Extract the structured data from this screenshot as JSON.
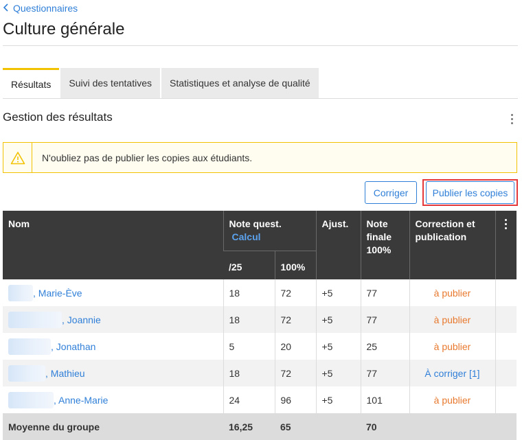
{
  "nav": {
    "back_label": "Questionnaires"
  },
  "page": {
    "title": "Culture générale"
  },
  "tabs": [
    {
      "label": "Résultats",
      "active": true
    },
    {
      "label": "Suivi des tentatives",
      "active": false
    },
    {
      "label": "Statistiques et analyse de qualité",
      "active": false
    }
  ],
  "section": {
    "title": "Gestion des résultats"
  },
  "alert": {
    "text": "N'oubliez pas de publier les copies aux étudiants."
  },
  "actions": {
    "corriger_label": "Corriger",
    "publier_label": "Publier les copies"
  },
  "table": {
    "headers": {
      "name": "Nom",
      "note_quest": "Note quest.",
      "calc_link": "Calcul",
      "adjust": "Ajust.",
      "final": "Note finale 100%",
      "correction": "Correction et publication",
      "sub_score": "/25",
      "sub_percent": "100%"
    },
    "rows": [
      {
        "name": ", Marie-Ève",
        "score": "18",
        "percent": "72",
        "adjust": "+5",
        "final": "77",
        "status": "à publier",
        "status_color": "#e8792e"
      },
      {
        "name": ", Joannie",
        "score": "18",
        "percent": "72",
        "adjust": "+5",
        "final": "77",
        "status": "à publier",
        "status_color": "#e8792e"
      },
      {
        "name": ", Jonathan",
        "score": "5",
        "percent": "20",
        "adjust": "+5",
        "final": "25",
        "status": "à publier",
        "status_color": "#e8792e"
      },
      {
        "name": ", Mathieu",
        "score": "18",
        "percent": "72",
        "adjust": "+5",
        "final": "77",
        "status": "À corriger [1]",
        "status_color": "#2f7fd8"
      },
      {
        "name": ", Anne-Marie",
        "score": "24",
        "percent": "96",
        "adjust": "+5",
        "final": "101",
        "status": "à publier",
        "status_color": "#e8792e"
      }
    ],
    "footer": {
      "label": "Moyenne du groupe",
      "score": "16,25",
      "percent": "65",
      "final": "70"
    }
  },
  "colors": {
    "accent": "#2f7fd8",
    "warning": "#f2c200",
    "publish": "#e8792e",
    "header_bg": "#3a3a3a",
    "highlight": "#e5383b"
  },
  "icons": {
    "back": "chevron-left-icon",
    "warning": "warning-triangle-icon",
    "more": "more-vertical-icon"
  }
}
